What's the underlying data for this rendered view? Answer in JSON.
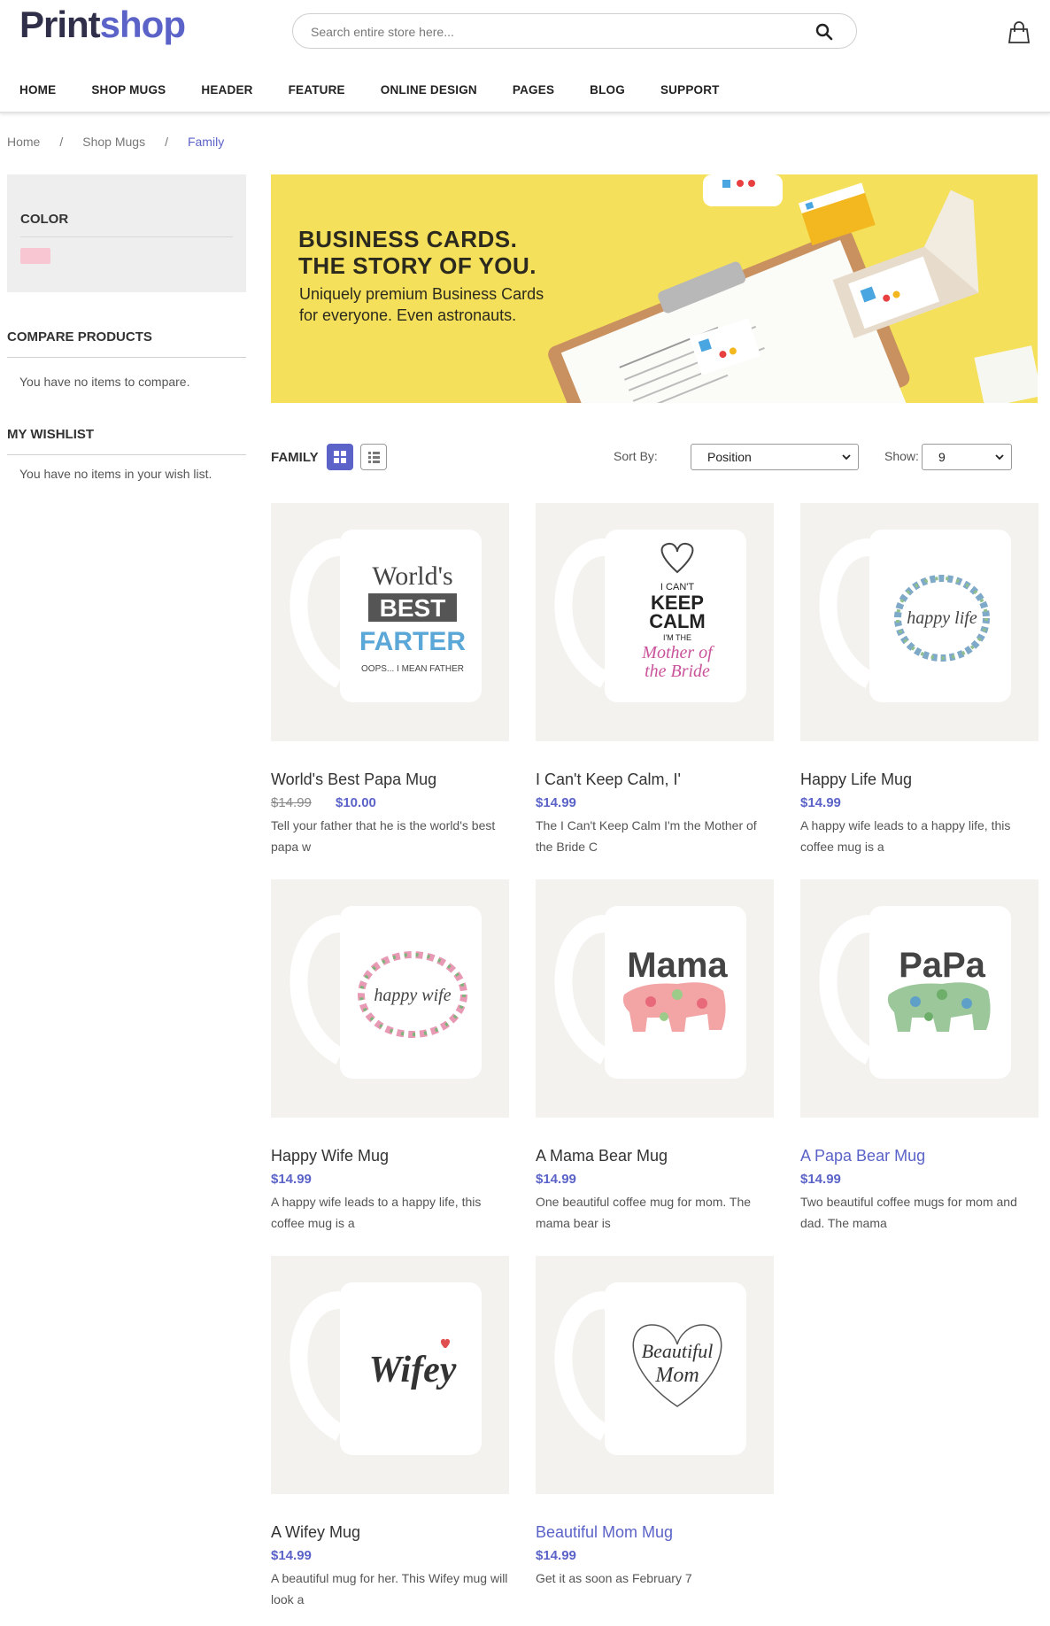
{
  "header": {
    "logo_part1": "Print",
    "logo_part2": "shop",
    "search_placeholder": "Search entire store here...",
    "nav": [
      "HOME",
      "SHOP MUGS",
      "HEADER",
      "FEATURE",
      "ONLINE DESIGN",
      "PAGES",
      "BLOG",
      "SUPPORT"
    ]
  },
  "breadcrumb": {
    "items": [
      "Home",
      "Shop Mugs",
      "Family"
    ],
    "separator": "/"
  },
  "sidebar": {
    "color_title": "COLOR",
    "color_swatch": "#f8c6d2",
    "compare_title": "COMPARE PRODUCTS",
    "compare_text": "You have no items to compare.",
    "wishlist_title": "MY WISHLIST",
    "wishlist_text": "You have no items in your wish list."
  },
  "banner": {
    "line1": "BUSINESS CARDS.",
    "line2": "THE STORY OF YOU.",
    "sub1": "Uniquely premium Business Cards",
    "sub2": "for everyone. Even astronauts."
  },
  "toolbar": {
    "category": "FAMILY",
    "sort_label": "Sort By:",
    "sort_value": "Position",
    "show_label": "Show:",
    "show_value": "9"
  },
  "products": [
    {
      "name": "World's Best Papa Mug",
      "old_price": "$14.99",
      "price": "$10.00",
      "desc": "Tell your father that he is the world's best papa w",
      "mug_text": [
        "World's",
        "BEST",
        "FARTER",
        "OOPS... I MEAN FATHER"
      ]
    },
    {
      "name": "I Can't Keep Calm, I'",
      "price": "$14.99",
      "desc": "The I Can't Keep Calm I'm the Mother of the Bride C",
      "mug_text": [
        "I CAN'T",
        "KEEP",
        "CALM",
        "I'M THE",
        "Mother of",
        "the Bride"
      ]
    },
    {
      "name": "Happy Life Mug",
      "price": "$14.99",
      "desc": "A happy wife leads to a happy life, this coffee mug is a",
      "mug_text": [
        "happy life"
      ]
    },
    {
      "name": "Happy Wife Mug",
      "price": "$14.99",
      "desc": "A happy wife leads to a happy life, this coffee mug is a",
      "mug_text": [
        "happy wife"
      ]
    },
    {
      "name": "A Mama Bear Mug",
      "price": "$14.99",
      "desc": "One beautiful coffee mug for mom. The mama bear is",
      "mug_text": [
        "Mama"
      ]
    },
    {
      "name": "A Papa Bear Mug",
      "price": "$14.99",
      "desc": "Two beautiful coffee mugs for mom and dad. The mama",
      "mug_text": [
        "PaPa"
      ]
    },
    {
      "name": "A Wifey Mug",
      "price": "$14.99",
      "desc": "A beautiful mug for her. This Wifey mug will look a",
      "mug_text": [
        "Wifey"
      ]
    },
    {
      "name": "Beautiful Mom Mug",
      "price": "$14.99",
      "desc": "Get it as soon as February 7",
      "mug_text": [
        "Beautiful",
        "Mom"
      ]
    }
  ],
  "colors": {
    "accent": "#5b63c8",
    "logo_dark": "#2f2f4a",
    "banner_bg": "#f4e05a"
  }
}
